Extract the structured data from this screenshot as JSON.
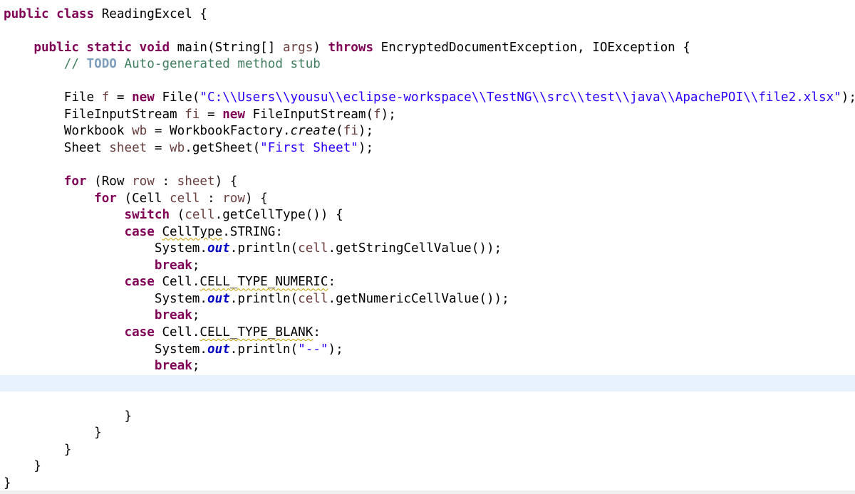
{
  "editor": {
    "language": "java",
    "current_line_index": 22,
    "colors": {
      "keyword": "#7f0055",
      "local_variable": "#6a3e3e",
      "string": "#2a00ff",
      "comment": "#3f7f5f",
      "todo_tag": "#7f9fbf",
      "static_field": "#0000c0",
      "current_line_bg": "#e8f2fe",
      "warning_underline": "#c8a000"
    },
    "lines": [
      [
        {
          "t": "public class",
          "c": "kw"
        },
        {
          "t": " ReadingExcel {"
        }
      ],
      [],
      [
        {
          "t": "    "
        },
        {
          "t": "public static void",
          "c": "kw"
        },
        {
          "t": " main(String[] "
        },
        {
          "t": "args",
          "c": "var"
        },
        {
          "t": ") "
        },
        {
          "t": "throws",
          "c": "kw"
        },
        {
          "t": " EncryptedDocumentException, IOException {"
        }
      ],
      [
        {
          "t": "        "
        },
        {
          "t": "// ",
          "c": "cmt"
        },
        {
          "t": "TODO",
          "c": "todo"
        },
        {
          "t": " Auto-generated method stub",
          "c": "cmt"
        }
      ],
      [],
      [
        {
          "t": "        File "
        },
        {
          "t": "f",
          "c": "var"
        },
        {
          "t": " = "
        },
        {
          "t": "new",
          "c": "kw"
        },
        {
          "t": " File("
        },
        {
          "t": "\"C:\\\\Users\\\\yousu\\\\eclipse-workspace\\\\TestNG\\\\src\\\\test\\\\java\\\\ApachePOI\\\\file2.xlsx\"",
          "c": "str"
        },
        {
          "t": ");"
        }
      ],
      [
        {
          "t": "        FileInputStream "
        },
        {
          "t": "fi",
          "c": "var"
        },
        {
          "t": " = "
        },
        {
          "t": "new",
          "c": "kw"
        },
        {
          "t": " FileInputStream("
        },
        {
          "t": "f",
          "c": "var"
        },
        {
          "t": ");"
        }
      ],
      [
        {
          "t": "        Workbook "
        },
        {
          "t": "wb",
          "c": "var"
        },
        {
          "t": " = WorkbookFactory."
        },
        {
          "t": "create",
          "c": "ital"
        },
        {
          "t": "("
        },
        {
          "t": "fi",
          "c": "var"
        },
        {
          "t": ");"
        }
      ],
      [
        {
          "t": "        Sheet "
        },
        {
          "t": "sheet",
          "c": "var"
        },
        {
          "t": " = "
        },
        {
          "t": "wb",
          "c": "var"
        },
        {
          "t": ".getSheet("
        },
        {
          "t": "\"First Sheet\"",
          "c": "str"
        },
        {
          "t": ");"
        }
      ],
      [],
      [
        {
          "t": "        "
        },
        {
          "t": "for",
          "c": "kw"
        },
        {
          "t": " (Row "
        },
        {
          "t": "row",
          "c": "var"
        },
        {
          "t": " : "
        },
        {
          "t": "sheet",
          "c": "var"
        },
        {
          "t": ") {"
        }
      ],
      [
        {
          "t": "            "
        },
        {
          "t": "for",
          "c": "kw"
        },
        {
          "t": " (Cell "
        },
        {
          "t": "cell",
          "c": "var"
        },
        {
          "t": " : "
        },
        {
          "t": "row",
          "c": "var"
        },
        {
          "t": ") {"
        }
      ],
      [
        {
          "t": "                "
        },
        {
          "t": "switch",
          "c": "kw"
        },
        {
          "t": " ("
        },
        {
          "t": "cell",
          "c": "var"
        },
        {
          "t": ".getCellType()) {"
        }
      ],
      [
        {
          "t": "                "
        },
        {
          "t": "case",
          "c": "kw"
        },
        {
          "t": " "
        },
        {
          "t": "CellType",
          "c": "warn"
        },
        {
          "t": ".STRING:"
        }
      ],
      [
        {
          "t": "                    System."
        },
        {
          "t": "out",
          "c": "fld"
        },
        {
          "t": ".println("
        },
        {
          "t": "cell",
          "c": "var"
        },
        {
          "t": ".getStringCellValue());"
        }
      ],
      [
        {
          "t": "                    "
        },
        {
          "t": "break",
          "c": "kw"
        },
        {
          "t": ";"
        }
      ],
      [
        {
          "t": "                "
        },
        {
          "t": "case",
          "c": "kw"
        },
        {
          "t": " Cell."
        },
        {
          "t": "CELL_TYPE_NUMERIC",
          "c": "warn"
        },
        {
          "t": ":"
        }
      ],
      [
        {
          "t": "                    System."
        },
        {
          "t": "out",
          "c": "fld"
        },
        {
          "t": ".println("
        },
        {
          "t": "cell",
          "c": "var"
        },
        {
          "t": ".getNumericCellValue());"
        }
      ],
      [
        {
          "t": "                    "
        },
        {
          "t": "break",
          "c": "kw"
        },
        {
          "t": ";"
        }
      ],
      [
        {
          "t": "                "
        },
        {
          "t": "case",
          "c": "kw"
        },
        {
          "t": " Cell."
        },
        {
          "t": "CELL_TYPE_BLANK",
          "c": "warn"
        },
        {
          "t": ":"
        }
      ],
      [
        {
          "t": "                    System."
        },
        {
          "t": "out",
          "c": "fld"
        },
        {
          "t": ".println("
        },
        {
          "t": "\"--\"",
          "c": "str"
        },
        {
          "t": ");"
        }
      ],
      [
        {
          "t": "                    "
        },
        {
          "t": "break",
          "c": "kw"
        },
        {
          "t": ";"
        }
      ],
      [],
      [],
      [
        {
          "t": "                }"
        }
      ],
      [
        {
          "t": "            }"
        }
      ],
      [
        {
          "t": "        }"
        }
      ],
      [
        {
          "t": "    }"
        }
      ],
      [
        {
          "t": "}"
        }
      ]
    ]
  }
}
